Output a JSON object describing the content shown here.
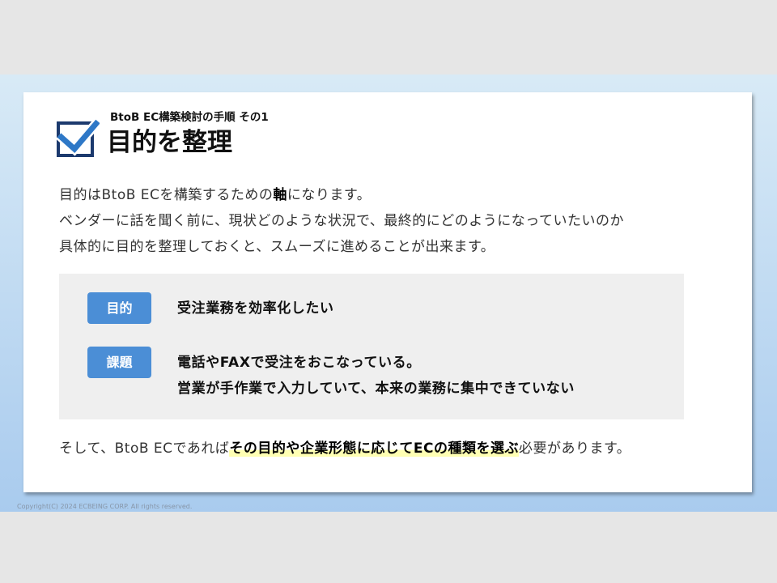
{
  "header": {
    "subtitle": "BtoB EC構築検討の手順 その1",
    "title": "目的を整理",
    "icon": "checked-checkbox-icon"
  },
  "intro": {
    "line1_before": "目的はBtoB ECを構築するための",
    "line1_bold": "軸",
    "line1_after": "になります。",
    "line2": "ベンダーに話を聞く前に、現状どのような状況で、最終的にどのようになっていたいのか",
    "line3": "具体的に目的を整理しておくと、スムーズに進めることが出来ます。"
  },
  "panel": {
    "rows": [
      {
        "badge": "目的",
        "lines": [
          "受注業務を効率化したい"
        ]
      },
      {
        "badge": "課題",
        "lines": [
          "電話やFAXで受注をおこなっている。",
          "営業が手作業で入力していて、本来の業務に集中できていない"
        ]
      }
    ]
  },
  "conclusion": {
    "before": "そして、BtoB ECであれば",
    "highlight": "その目的や企業形態に応じてECの種類を選ぶ",
    "after": "必要があります。"
  },
  "footer": {
    "copyright": "Copyright(C) 2024 ECBEING CORP. All rights reserved."
  },
  "colors": {
    "page_background": "#e6e6e6",
    "slide_gradient_top": "#d8eaf6",
    "slide_gradient_bottom": "#a9cbee",
    "badge": "#4b8ed6",
    "highlight": "#ffffb3",
    "icon_box": "#1c3a6e",
    "icon_check": "#2e78c7"
  }
}
